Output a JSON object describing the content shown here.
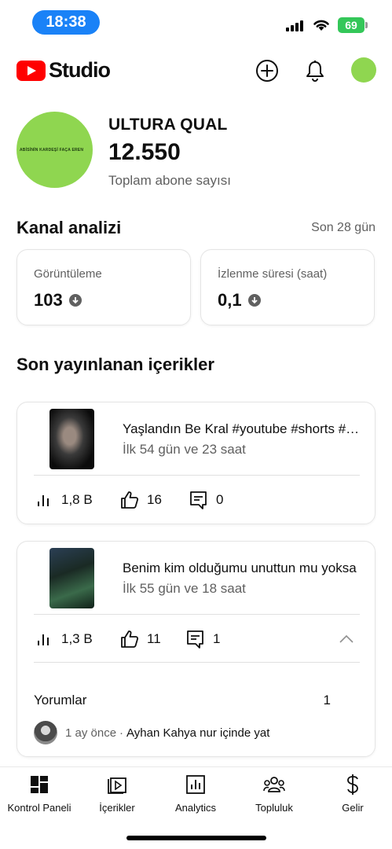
{
  "status_bar": {
    "time": "18:38",
    "battery": "69"
  },
  "header": {
    "brand": "Studio"
  },
  "channel": {
    "avatar_text": "ABİSİNİN KARDEŞİ FAÇA EREN",
    "name": "ULTURA QUAL",
    "subscriber_count": "12.550",
    "subscriber_label": "Toplam abone sayısı"
  },
  "analytics": {
    "title": "Kanal analizi",
    "period": "Son 28 gün",
    "cards": [
      {
        "label": "Görüntüleme",
        "value": "103"
      },
      {
        "label": "İzlenme süresi (saat)",
        "value": "0,1"
      }
    ]
  },
  "recent": {
    "title": "Son yayınlanan içerikler",
    "videos": [
      {
        "title": "Yaşlandın Be Kral #youtube #shorts #kral",
        "age": "İlk 54 gün ve 23 saat",
        "views": "1,8 B",
        "likes": "16",
        "comments": "0"
      },
      {
        "title": "Benim kim olduğumu unuttun mu yoksa",
        "age": "İlk 55 gün ve 18 saat",
        "views": "1,3 B",
        "likes": "11",
        "comments": "1"
      }
    ],
    "comments_section": {
      "title": "Yorumlar",
      "count": "1",
      "comment": {
        "time": "1 ay önce",
        "separator": "·",
        "text": "Ayhan Kahya nur içinde yat"
      }
    }
  },
  "nav": [
    {
      "label": "Kontrol Paneli",
      "icon": "dashboard-icon"
    },
    {
      "label": "İçerikler",
      "icon": "content-icon"
    },
    {
      "label": "Analytics",
      "icon": "analytics-icon"
    },
    {
      "label": "Topluluk",
      "icon": "community-icon"
    },
    {
      "label": "Gelir",
      "icon": "earn-icon"
    }
  ]
}
